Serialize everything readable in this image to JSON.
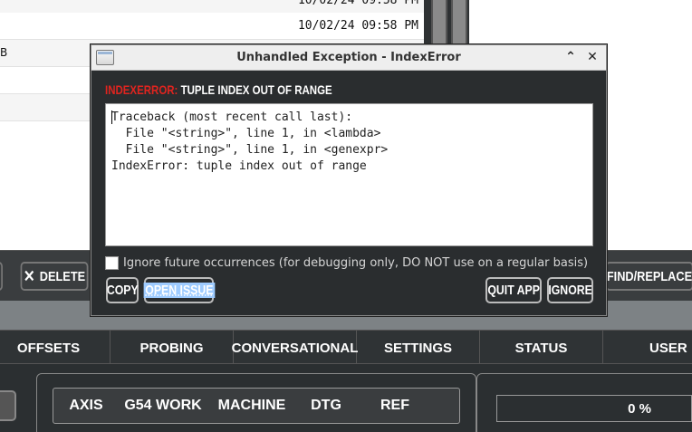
{
  "file_list": {
    "rows": [
      {
        "name": "",
        "date": "10/02/24  09:58 PM"
      },
      {
        "name": "",
        "date": "10/02/24  09:58 PM"
      },
      {
        "name": "B",
        "date": ""
      },
      {
        "name": "",
        "date": ""
      },
      {
        "name": "",
        "date": ""
      }
    ]
  },
  "toolbar": {
    "delete_label": "DELETE",
    "delete_icon": "close-icon",
    "find_replace_label": "FIND/REPLACE"
  },
  "main_tabs": [
    "OFFSETS",
    "PROBING",
    "CONVERSATIONAL",
    "SETTINGS",
    "STATUS",
    "USER"
  ],
  "dro_tabs": [
    "AXIS",
    "G54 WORK",
    "MACHINE",
    "DTG",
    "REF"
  ],
  "progress": {
    "value": 0,
    "label": "0 %"
  },
  "dialog": {
    "title": "Unhandled Exception - IndexError",
    "error_type": "INDEXERROR:",
    "error_message": "TUPLE INDEX OUT OF RANGE",
    "traceback": [
      "Traceback (most recent call last):",
      "  File \"<string>\", line 1, in <lambda>",
      "  File \"<string>\", line 1, in <genexpr>",
      "IndexError: tuple index out of range"
    ],
    "ignore_checkbox": {
      "checked": false,
      "label": "Ignore future occurrences (for debugging only, DO NOT use on a regular basis)"
    },
    "buttons": {
      "copy": "COPY",
      "open_issue": "OPEN ISSUE",
      "quit_app": "QUIT APP",
      "ignore": "IGNORE"
    },
    "controls": {
      "shade_icon": "chevron-up-icon",
      "close_icon": "close-icon"
    }
  },
  "colors": {
    "error_type": "#e0241f",
    "selection": "#9ecbff",
    "progress_fill": "#4a7fd1"
  }
}
